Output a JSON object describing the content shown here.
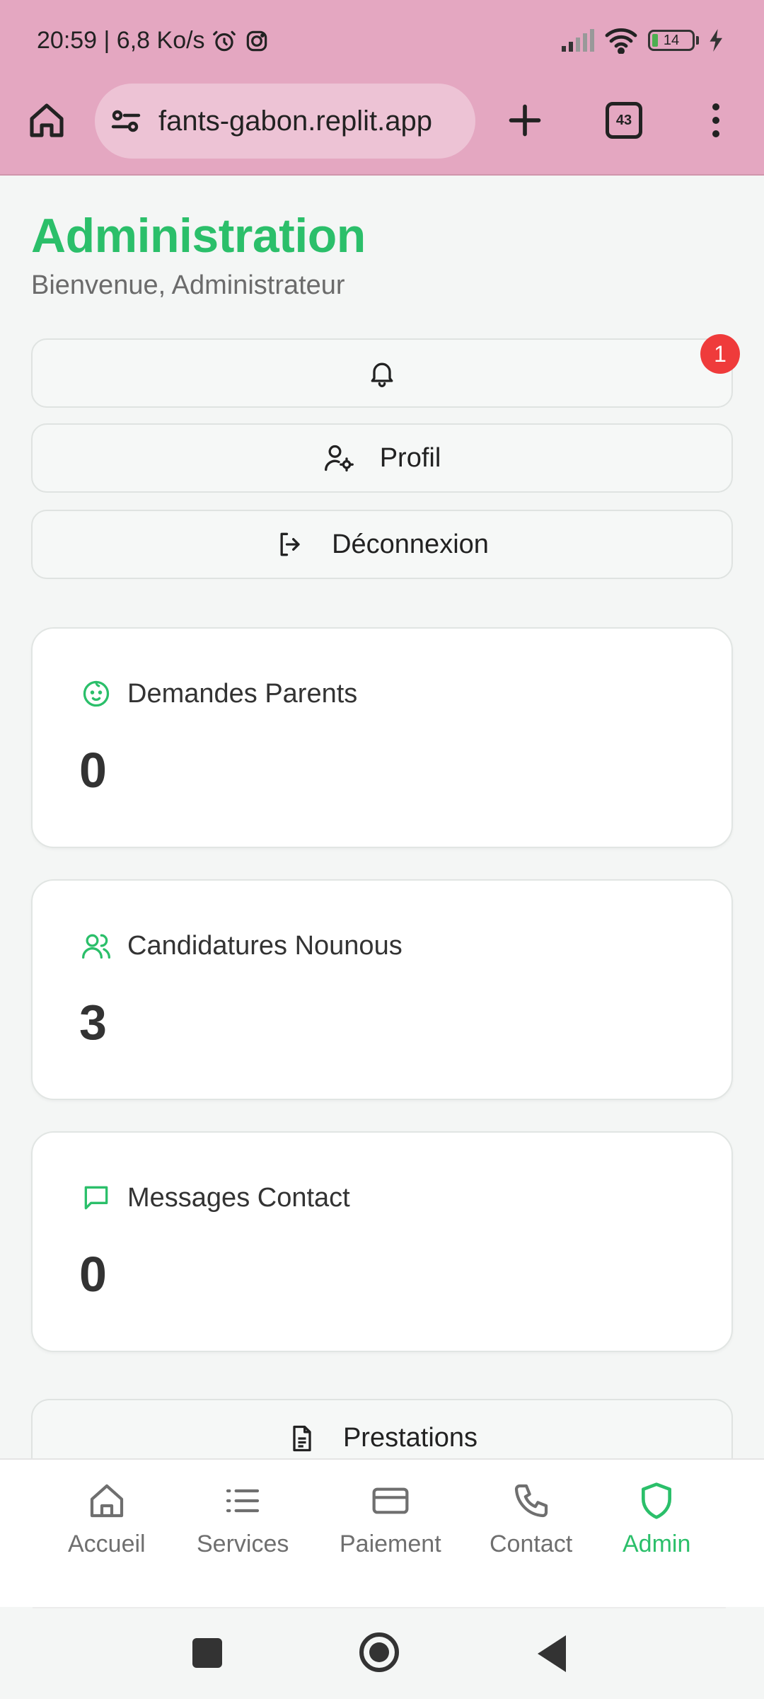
{
  "status_bar": {
    "time_speed": "20:59 | 6,8 Ko/s",
    "battery": "14",
    "icons": [
      "alarm-icon",
      "instagram-icon",
      "signal-icon",
      "wifi-icon",
      "battery-icon",
      "charging-icon"
    ]
  },
  "browser": {
    "url": "fants-gabon.replit.app",
    "tab_count": "43"
  },
  "header": {
    "title": "Administration",
    "subtitle": "Bienvenue, Administrateur"
  },
  "actions": {
    "notifications_badge": "1",
    "profile_label": "Profil",
    "logout_label": "Déconnexion"
  },
  "stats": [
    {
      "label": "Demandes Parents",
      "value": "0",
      "icon": "baby-icon"
    },
    {
      "label": "Candidatures Nounous",
      "value": "3",
      "icon": "users-icon"
    },
    {
      "label": "Messages Contact",
      "value": "0",
      "icon": "message-icon"
    }
  ],
  "prestations_label": "Prestations",
  "bottom_nav": [
    {
      "label": "Accueil",
      "icon": "home-icon",
      "active": false
    },
    {
      "label": "Services",
      "icon": "list-icon",
      "active": false
    },
    {
      "label": "Paiement",
      "icon": "credit-card-icon",
      "active": false
    },
    {
      "label": "Contact",
      "icon": "phone-icon",
      "active": false
    },
    {
      "label": "Admin",
      "icon": "shield-icon",
      "active": true
    }
  ],
  "colors": {
    "accent": "#2bbf6a",
    "browser_bar": "#e4a7c1",
    "badge": "#ef3b3b"
  }
}
